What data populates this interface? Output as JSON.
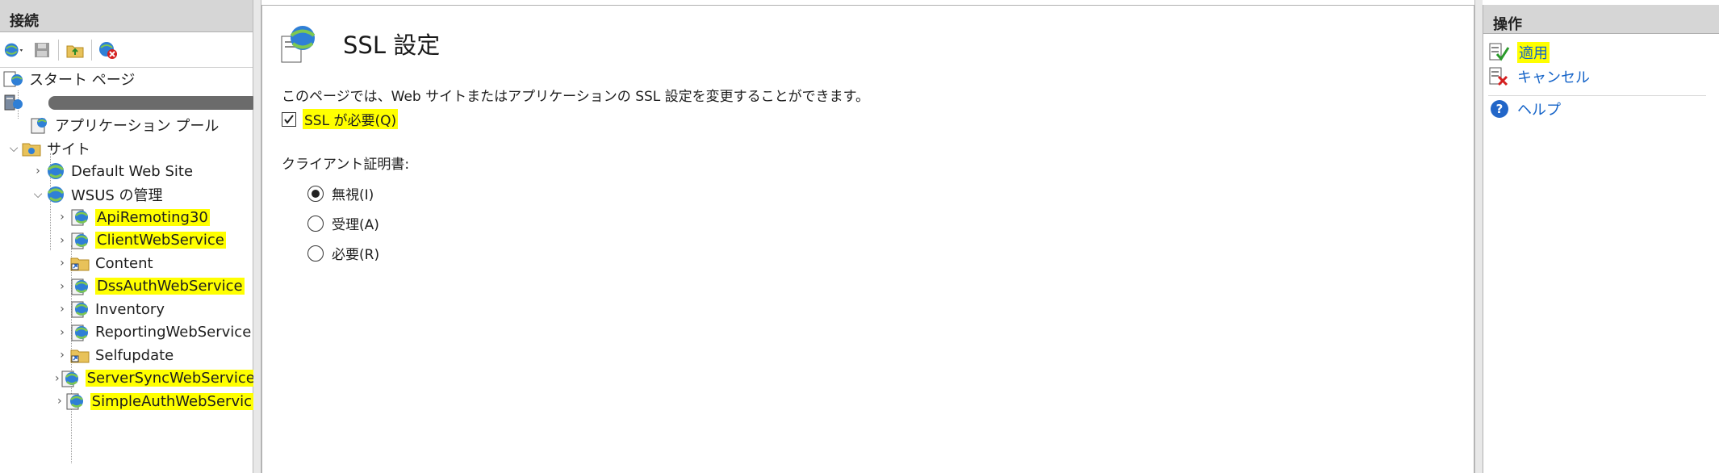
{
  "connections": {
    "header": "接続",
    "toolbar": [
      "connect-icon",
      "save-icon",
      "up-folder-icon",
      "disconnect-icon"
    ],
    "tree": {
      "start_page": "スタート ページ",
      "server": "",
      "app_pools": "アプリケーション プール",
      "sites": "サイト",
      "default_site": "Default Web Site",
      "wsus": "WSUS の管理",
      "children": [
        {
          "label": "ApiRemoting30",
          "highlight": true,
          "icon": "webapp-icon"
        },
        {
          "label": "ClientWebService",
          "highlight": true,
          "icon": "webapp-icon"
        },
        {
          "label": "Content",
          "highlight": false,
          "icon": "folder-shortcut-icon"
        },
        {
          "label": "DssAuthWebService",
          "highlight": true,
          "icon": "webapp-icon"
        },
        {
          "label": "Inventory",
          "highlight": false,
          "icon": "webapp-icon"
        },
        {
          "label": "ReportingWebService",
          "highlight": false,
          "icon": "webapp-icon"
        },
        {
          "label": "Selfupdate",
          "highlight": false,
          "icon": "folder-shortcut-icon"
        },
        {
          "label": "ServerSyncWebService",
          "highlight": true,
          "icon": "webapp-icon"
        },
        {
          "label": "SimpleAuthWebServic",
          "highlight": true,
          "icon": "webapp-icon"
        }
      ]
    }
  },
  "main": {
    "title": "SSL 設定",
    "description": "このページでは、Web サイトまたはアプリケーションの SSL 設定を変更することができます。",
    "require_ssl": {
      "label": "SSL が必要(Q)",
      "checked": true
    },
    "client_cert_label": "クライアント証明書:",
    "client_cert_options": [
      {
        "label": "無視(I)",
        "selected": true
      },
      {
        "label": "受理(A)",
        "selected": false
      },
      {
        "label": "必要(R)",
        "selected": false
      }
    ]
  },
  "actions": {
    "header": "操作",
    "apply": "適用",
    "cancel": "キャンセル",
    "help": "ヘルプ"
  },
  "colors": {
    "highlight": "#ffff00",
    "link": "#1463c8",
    "pane_header": "#d6d6d6"
  }
}
